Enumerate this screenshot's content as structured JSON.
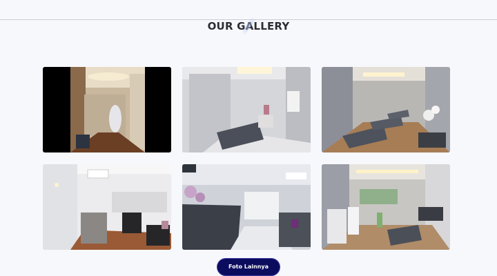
{
  "gallery": {
    "title": "OUR GALLERY",
    "photos": [
      {
        "name": "gallery-photo-hallway",
        "description": "beauty clinic hallway with mirror and chandelier"
      },
      {
        "name": "gallery-photo-treatment-bed",
        "description": "treatment room with single bed"
      },
      {
        "name": "gallery-photo-treatment-room-multi",
        "description": "treatment room with multiple beds and orchids"
      },
      {
        "name": "gallery-photo-lounge",
        "description": "waiting lounge with armchairs"
      },
      {
        "name": "gallery-photo-reception",
        "description": "reception area with marble counter"
      },
      {
        "name": "gallery-photo-equipment-room",
        "description": "room with aesthetic equipment and sofa"
      }
    ],
    "more_button_label": "Foto Lainnya"
  },
  "colors": {
    "background": "#f7f8fc",
    "title": "#2b2d33",
    "button_bg": "#0c0c5e",
    "button_text": "#ffffff"
  }
}
